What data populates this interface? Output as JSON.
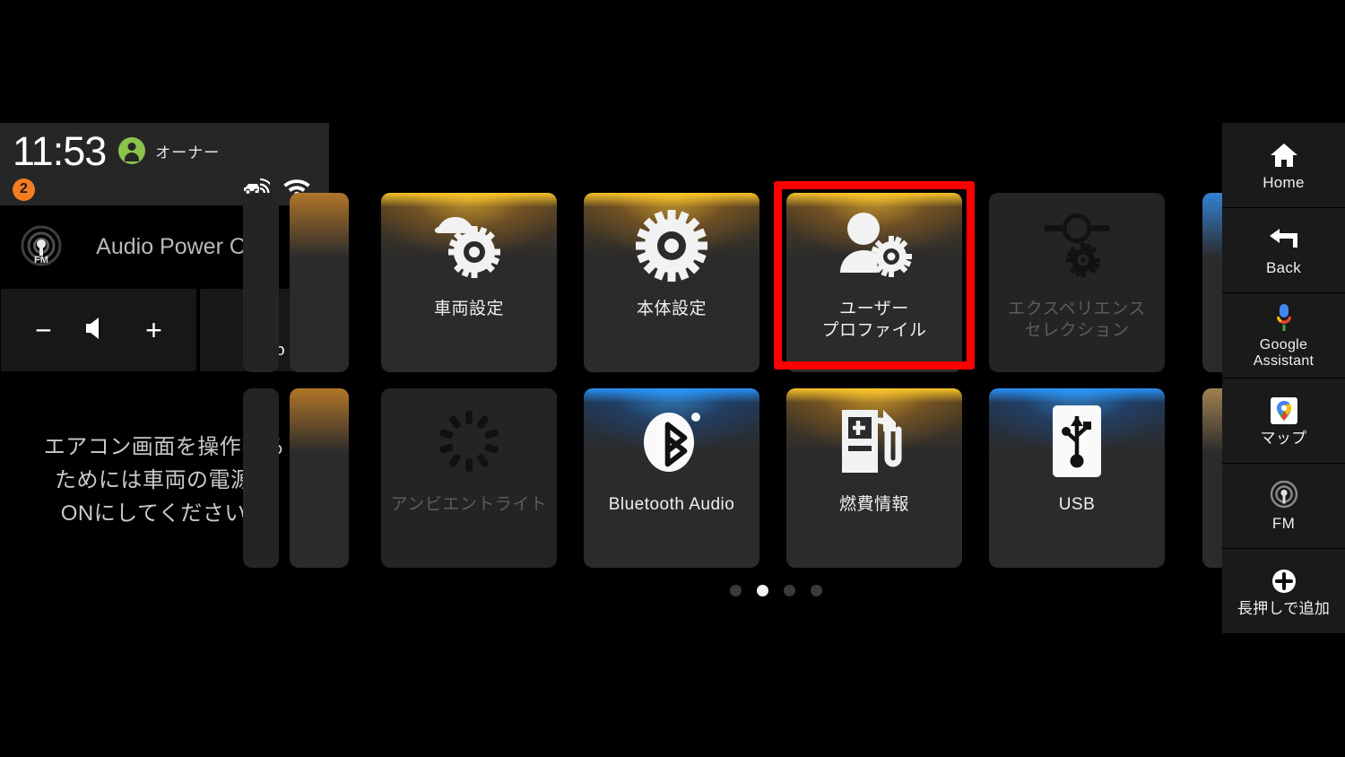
{
  "status_bar": {
    "time": "11:53",
    "user_name": "オーナー",
    "notification_count": "2",
    "icons": [
      "car-connectivity-icon",
      "wifi-icon"
    ]
  },
  "audio_panel": {
    "source_icon": "fm-radio-icon",
    "status_text": "Audio Power OFF",
    "volume_down": "−",
    "volume_icon": "speaker-icon",
    "volume_up": "+",
    "power_label": "Audio",
    "power_icon": "power-icon"
  },
  "hvac_message": {
    "line1": "エアコン画面を操作する",
    "line2": "ためには車両の電源を",
    "line3": "ONにしてください。"
  },
  "app_grid": {
    "row1": [
      {
        "label": "車両設定",
        "icon": "car-settings-icon",
        "accent": "amber",
        "dim": false,
        "highlighted": false
      },
      {
        "label": "本体設定",
        "icon": "gear-icon",
        "accent": "amber",
        "dim": false,
        "highlighted": false
      },
      {
        "label": "ユーザー\nプロファイル",
        "label_line1": "ユーザー",
        "label_line2": "プロファイル",
        "icon": "user-profile-settings-icon",
        "accent": "amber",
        "dim": false,
        "highlighted": true
      },
      {
        "label": "エクスペリエンス\nセレクション",
        "label_line1": "エクスペリエンス",
        "label_line2": "セレクション",
        "icon": "experience-slider-icon",
        "accent": "none",
        "dim": true,
        "highlighted": false
      }
    ],
    "row2": [
      {
        "label": "アンビエントライト",
        "icon": "ambient-light-icon",
        "accent": "none",
        "dim": true,
        "highlighted": false
      },
      {
        "label": "Bluetooth Audio",
        "icon": "bluetooth-icon",
        "accent": "blue",
        "dim": false,
        "highlighted": false
      },
      {
        "label": "燃費情報",
        "icon": "fuel-pump-icon",
        "accent": "amber",
        "dim": false,
        "highlighted": false
      },
      {
        "label": "USB",
        "icon": "usb-icon",
        "accent": "blue",
        "dim": false,
        "highlighted": false
      }
    ]
  },
  "pagination": {
    "total_pages": 4,
    "current_page": 2
  },
  "sidebar": {
    "items": [
      {
        "label": "Home",
        "icon": "home-icon"
      },
      {
        "label": "Back",
        "icon": "back-arrow-icon"
      },
      {
        "label_line1": "Google",
        "label_line2": "Assistant",
        "icon": "google-assistant-mic-icon"
      },
      {
        "label": "マップ",
        "icon": "google-maps-icon"
      },
      {
        "label": "FM",
        "icon": "fm-radio-icon"
      },
      {
        "label": "長押しで追加",
        "icon": "plus-circle-icon"
      }
    ]
  },
  "colors": {
    "accent_amber": "#FFC828",
    "accent_blue": "#2896FF",
    "highlight_red": "#FF0000",
    "badge_orange": "#F57C20",
    "avatar_green": "#8BC34A",
    "tile_bg": "#2b2b2b",
    "panel_bg": "#1a1a1a"
  }
}
